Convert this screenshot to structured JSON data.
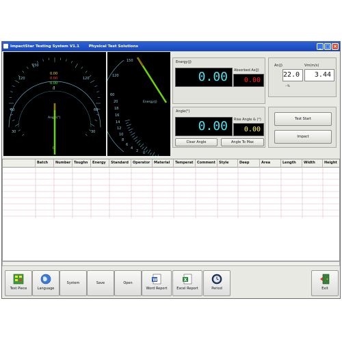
{
  "window": {
    "title": "ImpactStar Testing System V1.1       Physical Test Solutions"
  },
  "gauge_left": {
    "ticks_outer": [
      "150",
      "120",
      "120",
      "60",
      "30",
      "60",
      "30",
      "0"
    ],
    "ticks_inner": [
      "0.00",
      "0.00",
      "0.00",
      "/J"
    ],
    "unit_label": "Angle(°)"
  },
  "gauge_right": {
    "ticks": [
      "150",
      "120",
      "60",
      "20",
      "18",
      "16",
      "14",
      "12",
      "10",
      "8",
      "6",
      "4",
      "2",
      "0"
    ],
    "unit_label": "Energy(J)"
  },
  "energy": {
    "label": "Energy(J)",
    "value": "0.00",
    "absorbed_label": "Absorbed As(J)",
    "absorbed_value": "0.00"
  },
  "angle": {
    "label": "Angle(°)",
    "value": "0.00",
    "rise_label": "Rise Angle & (°)",
    "rise_value": "0.00",
    "clear_button": "Clear Angle",
    "max_button": "Angle To Max"
  },
  "right_panel": {
    "a_label": "An(J)",
    "a_value": "22.0",
    "v_label": "Vm(m/s)",
    "v_value": "3.44",
    "small_note": "--%",
    "test_start": "Test Start",
    "impact": "Impact"
  },
  "table": {
    "columns": [
      "",
      "Batch",
      "Number",
      "Toughn",
      "Energy",
      "Standard",
      "Operator",
      "Material",
      "Temperat",
      "Comment",
      "Style",
      "Deep",
      "Area",
      "Length",
      "Width",
      "Height"
    ]
  },
  "toolbar": {
    "test_piece": "Test Piece",
    "language": "Language",
    "system": "System",
    "save": "Save",
    "open": "Open",
    "word_report": "Word Report",
    "excel_report": "Excel Report",
    "period": "Period",
    "exit": "Exit"
  },
  "colors": {
    "lcd_cyan": "#48e4f0",
    "lcd_red": "#ff2020",
    "lcd_yellow": "#ffff55",
    "needle_green": "#6ad800",
    "needle_red": "#e01010",
    "title_blue": "#2a63d8"
  }
}
